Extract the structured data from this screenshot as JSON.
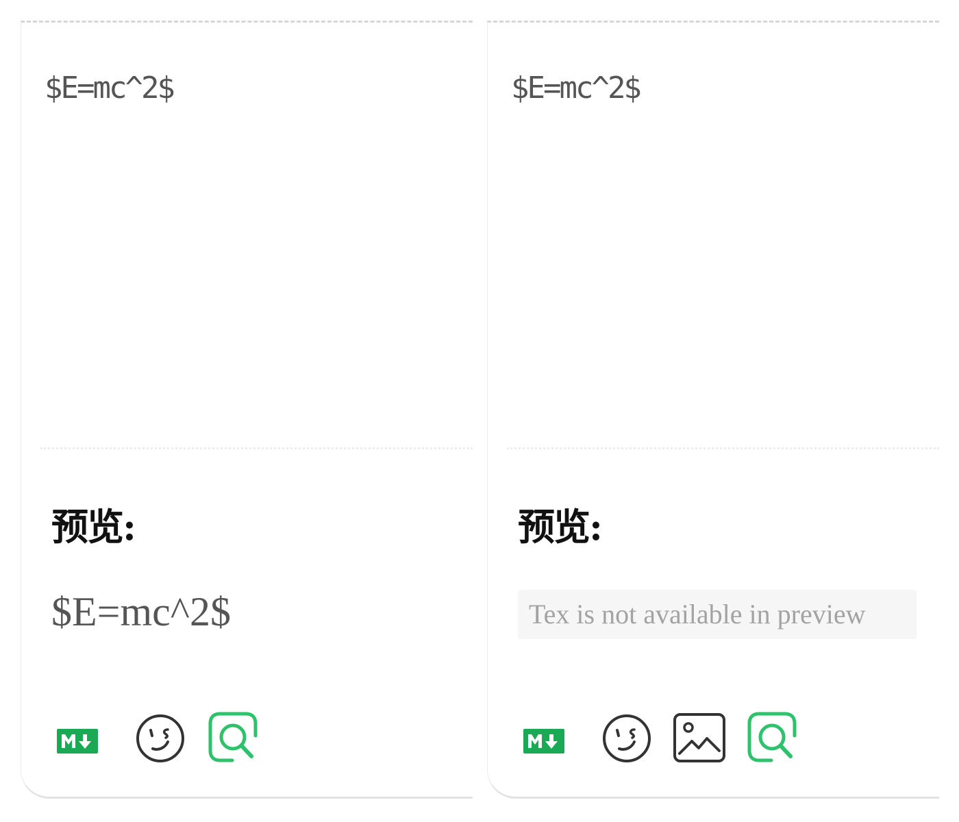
{
  "editors": [
    {
      "source_text": "$E=mc^2$",
      "preview_label": "预览:",
      "preview_content": "$E=mc^2$",
      "toolbar_icons": [
        "markdown-icon",
        "emoji-icon",
        "preview-icon"
      ]
    },
    {
      "source_text": "$E=mc^2$",
      "preview_label": "预览:",
      "preview_note": "Tex is not available in preview",
      "toolbar_icons": [
        "markdown-icon",
        "emoji-icon",
        "image-icon",
        "preview-icon"
      ]
    }
  ],
  "colors": {
    "accent_green": "#1aaa55",
    "preview_green": "#2dc26b",
    "icon_dark": "#333333"
  }
}
